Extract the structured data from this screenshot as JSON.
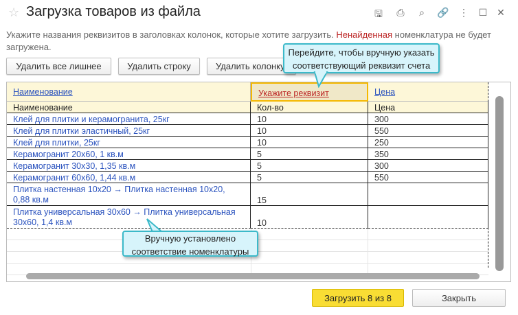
{
  "window": {
    "title": "Загрузка товаров из файла",
    "icons": [
      "star-icon",
      "save-icon",
      "print-icon",
      "preview-icon",
      "link-icon",
      "more-icon",
      "maximize-icon",
      "close-icon"
    ]
  },
  "hint": {
    "part1": "Укажите названия реквизитов в заголовках колонок, которые хотите загрузить. ",
    "highlight": "Ненайденная",
    "part2": " номенклатура не будет загружена."
  },
  "toolbar": {
    "delete_all_extra": "Удалить все лишнее",
    "delete_row": "Удалить строку",
    "delete_column": "Удалить колонку"
  },
  "table": {
    "mapping_headers": [
      "Наименование",
      "Укажите реквизит",
      "Цена"
    ],
    "file_headers": [
      "Наименование",
      "Кол-во",
      "Цена"
    ],
    "rows": [
      [
        "Клей для плитки и керамогранита, 25кг",
        "10",
        "300"
      ],
      [
        "Клей для плитки эластичный, 25кг",
        "10",
        "550"
      ],
      [
        "Клей для плитки, 25кг",
        "10",
        "250"
      ],
      [
        "Керамогранит 20x60, 1 кв.м",
        "5",
        "350"
      ],
      [
        "Керамогранит 30x30, 1,35 кв.м",
        "5",
        "300"
      ],
      [
        "Керамогранит 60x60, 1,44 кв.м",
        "5",
        "550"
      ],
      [
        "Плитка настенная 10x20 → Плитка настенная 10x20, 0,88 кв.м",
        "15",
        ""
      ],
      [
        "Плитка универсальная 30x60 → Плитка универсальная 30x60, 1,4 кв.м",
        "10",
        ""
      ]
    ]
  },
  "callouts": {
    "top": "Перейдите, чтобы вручную указать соответствующий реквизит счета",
    "bottom": "Вручную установлено соответствие номенклатуры"
  },
  "footer": {
    "load": "Загрузить 8 из 8",
    "close": "Закрыть"
  },
  "colors": {
    "accent": "#f9dd34",
    "header_bg": "#fdf7d8",
    "link": "#2a52be",
    "warning": "#b22222",
    "callout": "#d7f4fb"
  }
}
